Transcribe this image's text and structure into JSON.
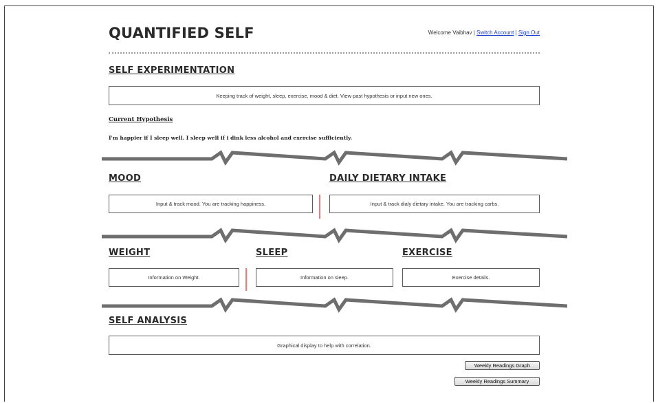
{
  "header": {
    "brand": "QUANTIFIED SELF",
    "welcome_text": "Welcome Vaibhav |",
    "separator": "|",
    "switch_account": "Switch Account",
    "sign_out": "Sign Out"
  },
  "self_experimentation": {
    "heading": "SELF EXPERIMENTATION",
    "description": "Keeping track of weight, sleep, exercise, mood & diet. View past hypothesis or input new ones.",
    "hypothesis_label": "Current Hypothesis",
    "hypothesis_text": "I'm happier if I sleep well. I sleep well if i dink less alcohol and exercise sufficiently."
  },
  "mood": {
    "heading": "MOOD",
    "description": "Input & track mood. You are tracking happiness."
  },
  "diet": {
    "heading": "DAILY DIETARY INTAKE",
    "description": "Input & track dialy dietary intake. You are tracking carbs."
  },
  "weight": {
    "heading": "WEIGHT",
    "description": "Information on Weight."
  },
  "sleep": {
    "heading": "SLEEP",
    "description": "Information on sleep."
  },
  "exercise": {
    "heading": "EXERCISE",
    "description": "Exercise details."
  },
  "self_analysis": {
    "heading": "SELF ANALYSIS",
    "description": "Graphical display to help with correlation.",
    "graph_button": "Weekly Readings Graph",
    "summary_button": "Weekly Readings Summary"
  },
  "colors": {
    "divider": "#6e6e6e",
    "separator_red": "#f07a7a",
    "link": "#1a3fd1"
  }
}
